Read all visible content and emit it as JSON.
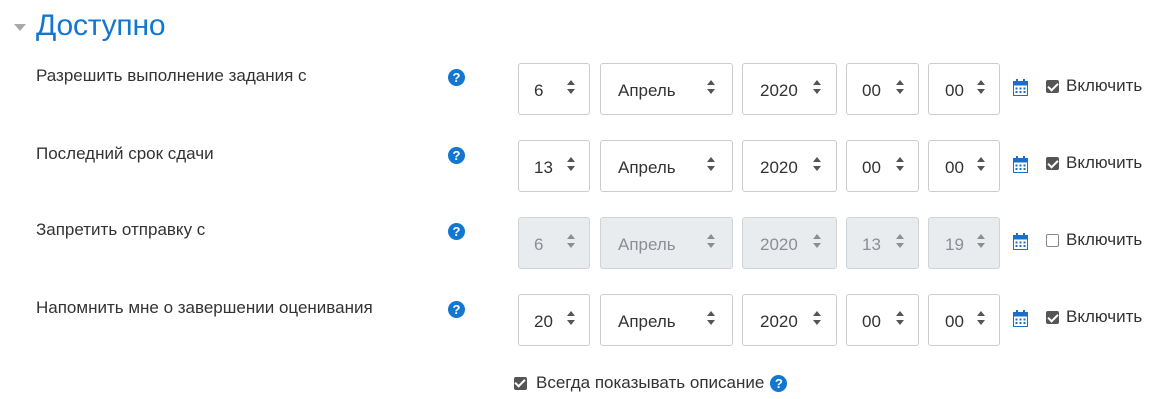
{
  "section": {
    "title": "Доступно",
    "toggle_icon": "chevron-down-icon"
  },
  "rows": [
    {
      "label": "Разрешить выполнение задания с",
      "day": "6",
      "month": "Апрель",
      "year": "2020",
      "hour": "00",
      "minute": "00",
      "enabled": true,
      "enable_label": "Включить"
    },
    {
      "label": "Последний срок сдачи",
      "day": "13",
      "month": "Апрель",
      "year": "2020",
      "hour": "00",
      "minute": "00",
      "enabled": true,
      "enable_label": "Включить"
    },
    {
      "label": "Запретить отправку с",
      "day": "6",
      "month": "Апрель",
      "year": "2020",
      "hour": "13",
      "minute": "19",
      "enabled": false,
      "enable_label": "Включить"
    },
    {
      "label": "Напомнить мне о завершении оценивания",
      "day": "20",
      "month": "Апрель",
      "year": "2020",
      "hour": "00",
      "minute": "00",
      "enabled": true,
      "enable_label": "Включить"
    }
  ],
  "always_show_description": {
    "label": "Всегда показывать описание",
    "checked": true
  },
  "icons": {
    "help": "help-icon",
    "calendar": "calendar-icon"
  },
  "colors": {
    "accent": "#1177d1",
    "calendar": "#1b6fc8"
  }
}
